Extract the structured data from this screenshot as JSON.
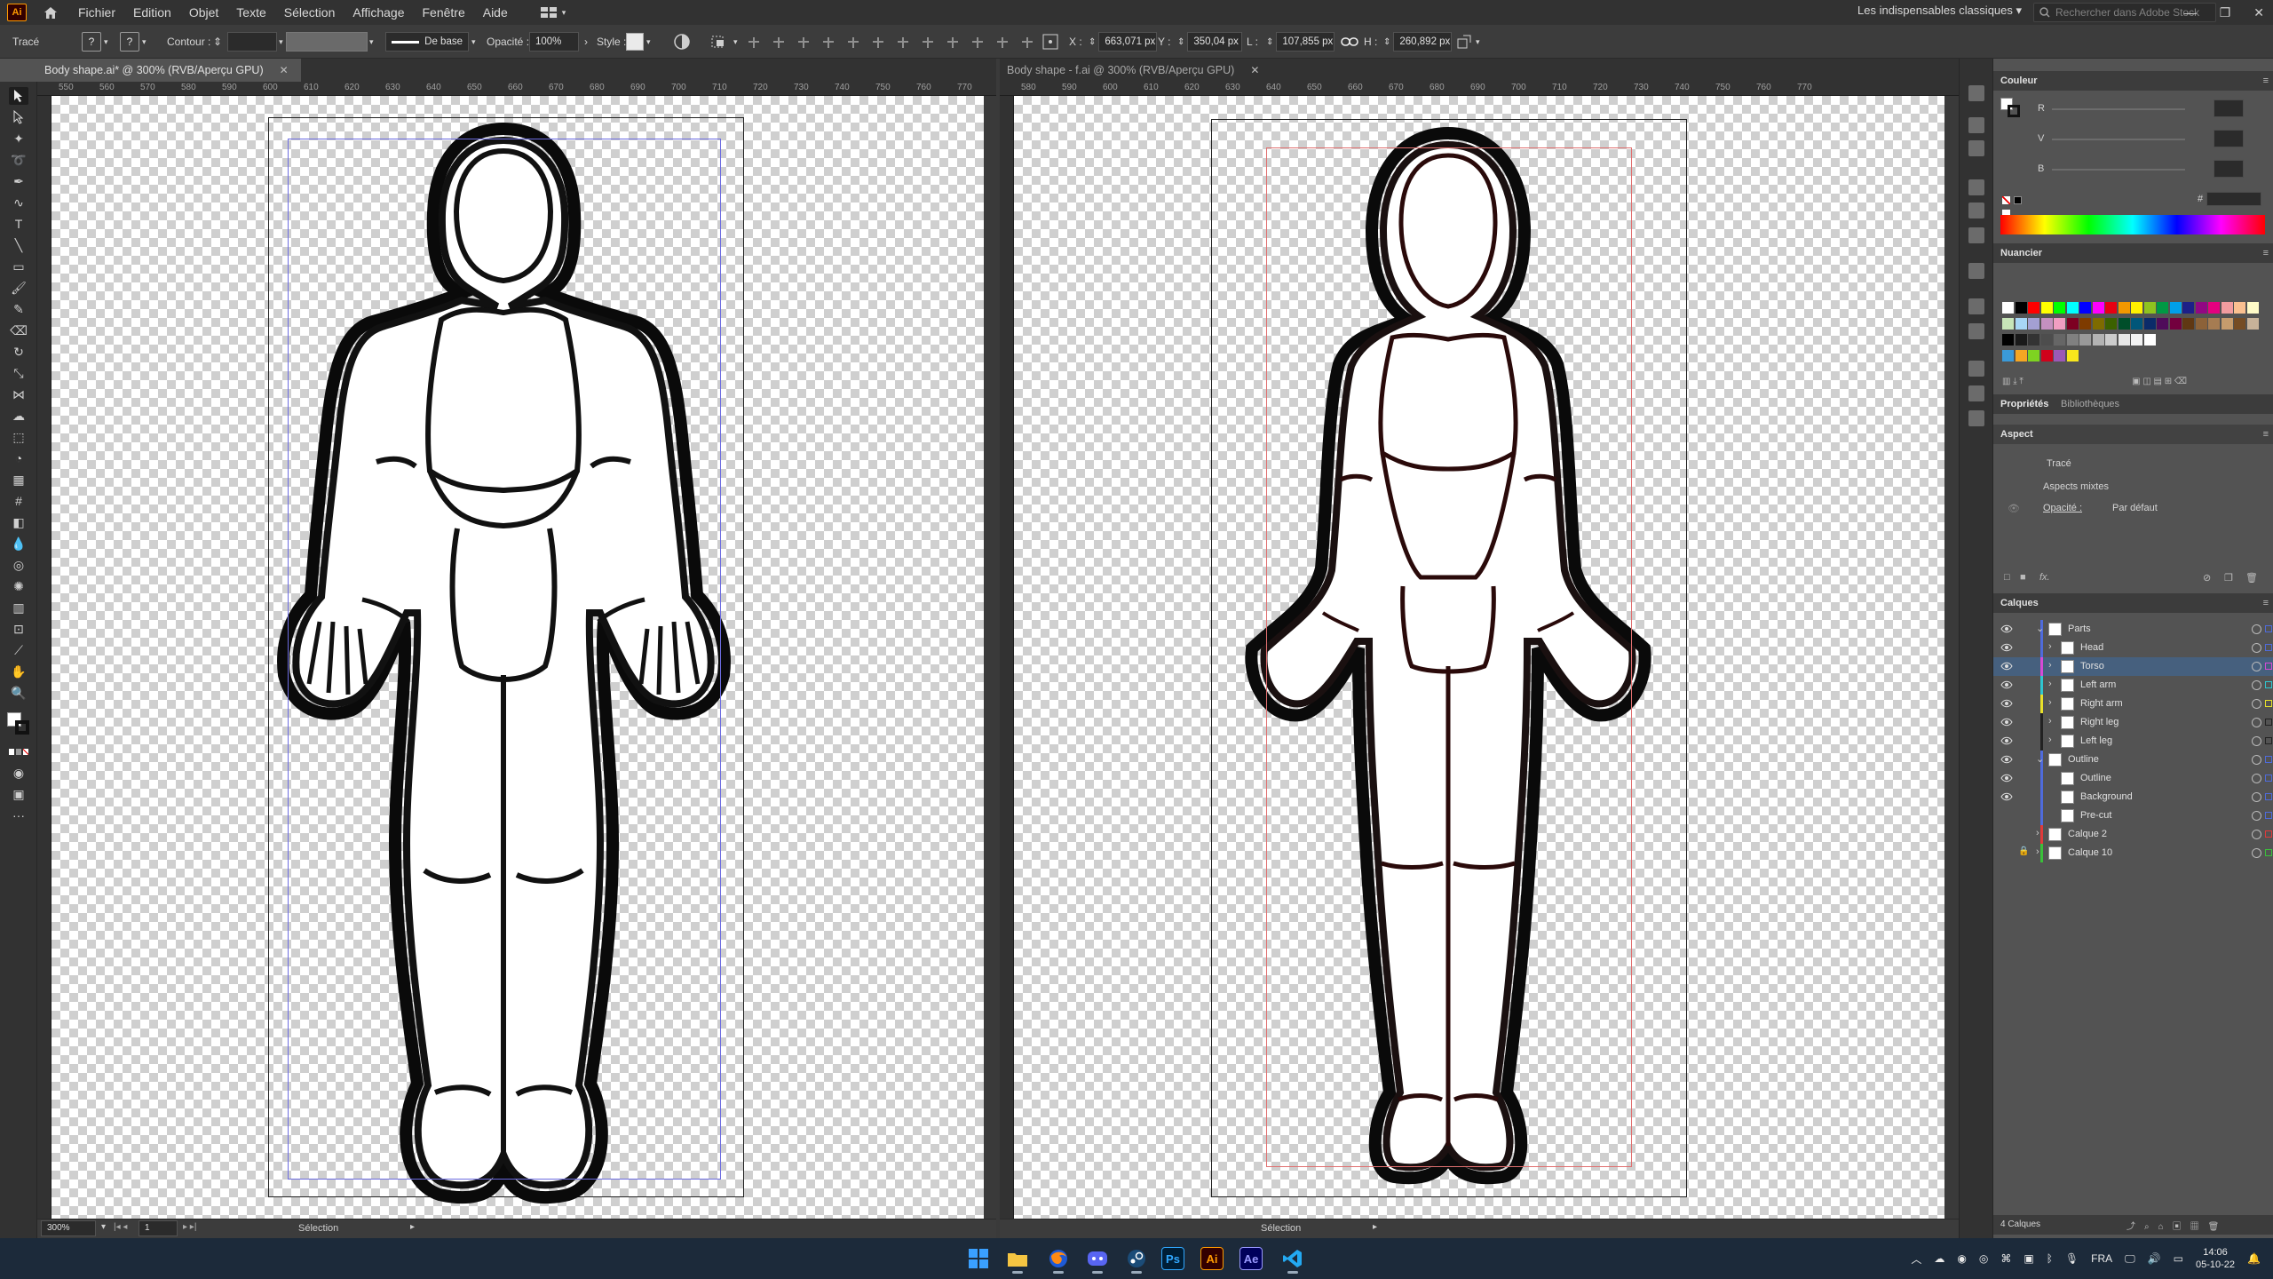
{
  "app": {
    "logo": "Ai"
  },
  "menu": [
    "Fichier",
    "Edition",
    "Objet",
    "Texte",
    "Sélection",
    "Affichage",
    "Fenêtre",
    "Aide"
  ],
  "workspace": "Les indispensables classiques",
  "search_placeholder": "Rechercher dans Adobe Stock",
  "control_bar": {
    "object_type": "Tracé",
    "stroke_label": "Contour :",
    "brush": "De base",
    "opacity_label": "Opacité :",
    "opacity": "100%",
    "style_label": "Style :",
    "x_label": "X :",
    "x": "663,071 px",
    "y_label": "Y :",
    "y": "350,04 px",
    "w_label": "L :",
    "w": "107,855 px",
    "h_label": "H :",
    "h": "260,892 px"
  },
  "documents": [
    {
      "tab": "Body shape.ai* @ 300% (RVB/Aperçu GPU)",
      "zoom": "300%",
      "page": "1",
      "status": "Sélection",
      "ruler": [
        "550",
        "560",
        "570",
        "580",
        "590",
        "600",
        "610",
        "620",
        "630",
        "640",
        "650",
        "660",
        "670",
        "680",
        "690",
        "700",
        "710",
        "720",
        "730",
        "740",
        "750",
        "760",
        "770"
      ]
    },
    {
      "tab": "Body shape - f.ai @ 300% (RVB/Aperçu GPU)",
      "status": "Sélection",
      "ruler": [
        "580",
        "590",
        "600",
        "610",
        "620",
        "630",
        "640",
        "650",
        "660",
        "670",
        "680",
        "690",
        "700",
        "710",
        "720",
        "730",
        "740",
        "750",
        "760",
        "770"
      ]
    }
  ],
  "panels": {
    "color": {
      "title": "Couleur",
      "r": "R",
      "v": "V",
      "b": "B",
      "hex_prefix": "#"
    },
    "swatches": {
      "title": "Nuancier"
    },
    "properties": {
      "tab_props": "Propriétés",
      "tab_libs": "Bibliothèques",
      "section": "Aspect",
      "stroke": "Tracé",
      "mixed": "Aspects mixtes",
      "opacity_label": "Opacité :",
      "opacity_value": "Par défaut",
      "fx": "fx."
    },
    "layers": {
      "title": "Calques",
      "count": "4 Calques",
      "items": [
        {
          "name": "Parts",
          "color": "#4f6bdb"
        },
        {
          "name": "Head",
          "color": "#4f6bdb"
        },
        {
          "name": "Torso",
          "color": "#d64ad6"
        },
        {
          "name": "Left arm",
          "color": "#2fc6d0"
        },
        {
          "name": "Right arm",
          "color": "#e8e02a"
        },
        {
          "name": "Right leg",
          "color": "#222222"
        },
        {
          "name": "Left leg",
          "color": "#222222"
        },
        {
          "name": "Outline",
          "color": "#4f6bdb"
        },
        {
          "name": "Outline",
          "color": "#4f6bdb"
        },
        {
          "name": "Background",
          "color": "#4f6bdb"
        },
        {
          "name": "Pre-cut",
          "color": "#4f6bdb"
        },
        {
          "name": "Calque 2",
          "color": "#e03a3a"
        },
        {
          "name": "Calque 10",
          "color": "#3ac03a"
        }
      ]
    }
  },
  "taskbar": {
    "apps": [
      "windows-logo",
      "file-explorer",
      "firefox",
      "discord",
      "steam",
      "Ps",
      "Ai",
      "Ae",
      "vscode"
    ],
    "language": "FRA",
    "time": "14:06",
    "date": "05-10-22"
  }
}
